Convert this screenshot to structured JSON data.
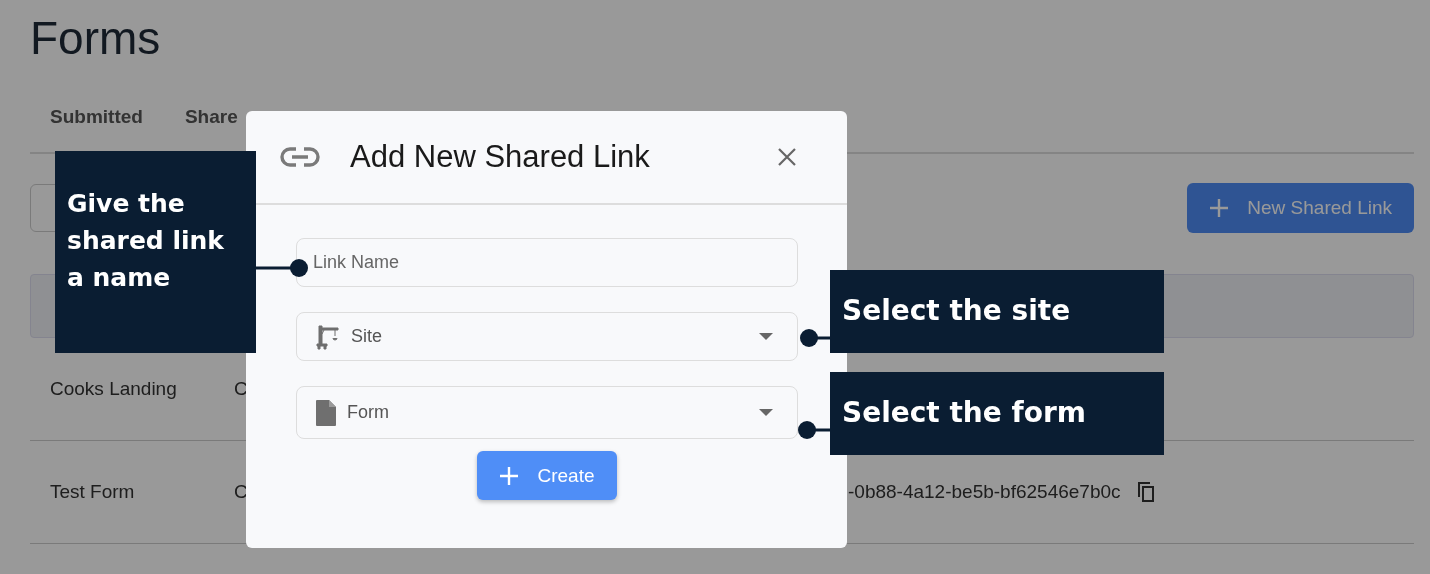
{
  "page": {
    "title": "Forms",
    "tabs": [
      "Submitted",
      "Share"
    ],
    "new_button": "New Shared Link",
    "rows": [
      {
        "column_1": "Cooks Landing",
        "column_2": "C"
      },
      {
        "column_1": "Test Form",
        "column_2": "C",
        "column_3": "-0b88-4a12-be5b-bf62546e7b0c"
      }
    ]
  },
  "dialog": {
    "title": "Add New Shared Link",
    "fields": [
      {
        "kind": "text",
        "placeholder": "Link Name"
      },
      {
        "kind": "site",
        "label": "Site"
      },
      {
        "kind": "form",
        "label": "Form"
      }
    ],
    "button": "Create"
  },
  "callouts": [
    {
      "text": "Give the shared link a name"
    },
    {
      "text": "Select the site"
    },
    {
      "text": "Select the form"
    }
  ]
}
